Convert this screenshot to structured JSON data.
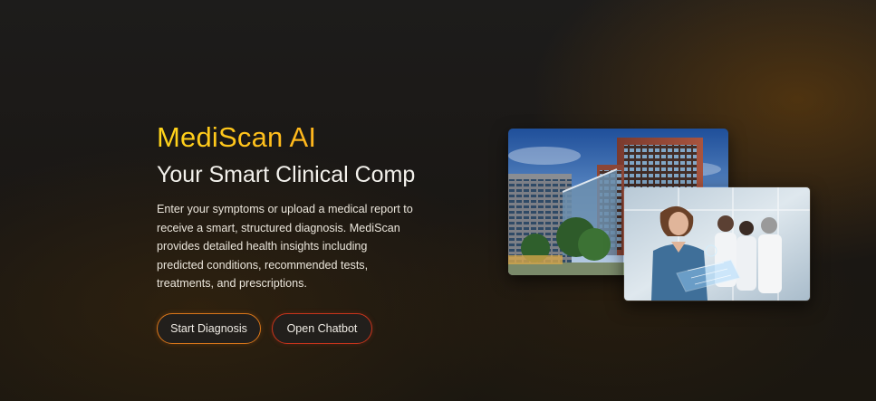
{
  "hero": {
    "brand": "MediScan AI",
    "subtitle": "Your Smart Clinical Comp",
    "description": "Enter your symptoms or upload a medical report to receive a smart, structured diagnosis. MediScan provides detailed health insights including predicted conditions, recommended tests, treatments, and prescriptions."
  },
  "buttons": {
    "start_diagnosis": "Start Diagnosis",
    "open_chatbot": "Open Chatbot"
  },
  "images": {
    "hospital_alt": "Hospital building",
    "staff_alt": "Medical staff with holographic tablet"
  },
  "colors": {
    "brand_gradient_start": "#ffd51a",
    "brand_gradient_end": "#f09a1e",
    "button_border_primary": "#d8761a",
    "button_border_secondary": "#c8341c",
    "background": "#1a1714"
  }
}
